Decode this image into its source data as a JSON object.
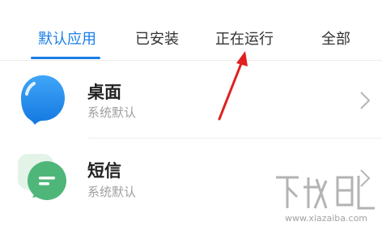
{
  "tabs": [
    {
      "label": "默认应用",
      "active": true
    },
    {
      "label": "已安装",
      "active": false
    },
    {
      "label": "正在运行",
      "active": false
    },
    {
      "label": "全部",
      "active": false
    }
  ],
  "apps": [
    {
      "name": "桌面",
      "subtitle": "系统默认",
      "icon": "desktop-app-icon",
      "icon_color": "#2a8ff0"
    },
    {
      "name": "短信",
      "subtitle": "系统默认",
      "icon": "messages-app-icon",
      "icon_color": "#4fb67a"
    }
  ],
  "annotation": {
    "arrow_color": "#e02020"
  },
  "watermark": {
    "text": "下载吧",
    "url_text": "www.xiazaiba.com"
  },
  "colors": {
    "accent": "#1a7ee8"
  }
}
